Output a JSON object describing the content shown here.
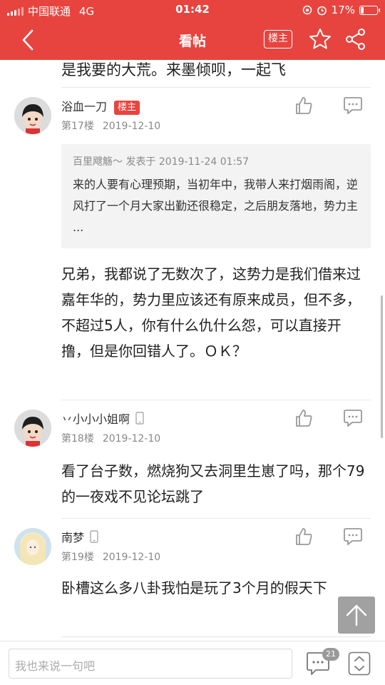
{
  "status_bar": {
    "carrier": "中国联通",
    "network": "4G",
    "time": "01:42",
    "battery": "17%"
  },
  "nav": {
    "title": "看帖",
    "owner_only_label": "楼主"
  },
  "partial_post_text": "是我要的大荒。来墨倾呗，一起飞",
  "posts": [
    {
      "username": "浴血一刀",
      "badge": "楼主",
      "floor": "第17楼",
      "date": "2019-12-10",
      "quote": {
        "header": "百里飕觞～ 发表于 2019-11-24 01:57",
        "body": " 来的人要有心理预期，当初年中，我带人来打烟雨阁，逆风打了一个月大家出勤还很稳定，之后朋友落地，势力主 ..."
      },
      "body": "兄弟，我都说了无数次了，这势力是我们借来过嘉年华的，势力里应该还有原来成员，但不多，不超过5人，你有什么仇什么怨，可以直接开撸，但是你回错人了。ＯＫ？"
    },
    {
      "username": "丷小小小姐啊",
      "floor": "第18楼",
      "date": "2019-12-10",
      "body": "看了台子数，燃烧狗又去洞里生崽了吗，那个79的一夜戏不见论坛跳了"
    },
    {
      "username": "南梦",
      "floor": "第19楼",
      "date": "2019-12-10",
      "body": "卧槽这么多八卦我怕是玩了3个月的假天下"
    }
  ],
  "bottom_bar": {
    "input_placeholder": "我也来说一句吧",
    "comment_count": "21"
  },
  "colors": {
    "brand": "#e8443f",
    "quote_bg": "#f3f3f3"
  },
  "icons": [
    "back-icon",
    "star-icon",
    "share-icon",
    "thumbs-up-icon",
    "reply-icon",
    "phone-icon",
    "back-to-top-icon",
    "comment-icon",
    "up-down-icon"
  ]
}
